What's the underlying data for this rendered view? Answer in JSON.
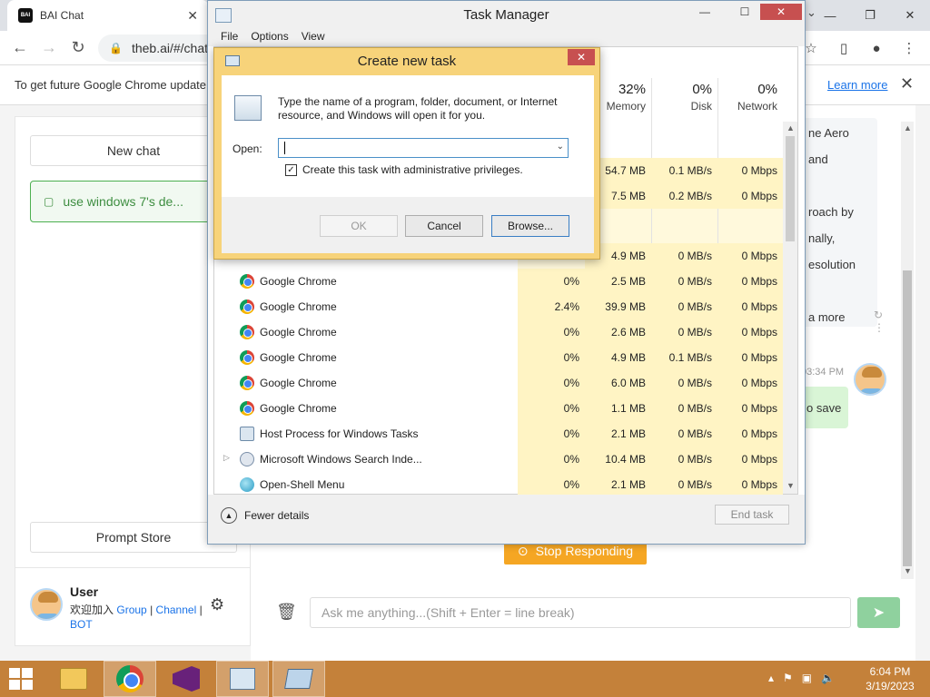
{
  "browser": {
    "tab_title": "BAI Chat",
    "favicon_text": "BAI",
    "url": "theb.ai/#/chat",
    "infobar_text": "To get future Google Chrome update",
    "infobar_link": "Learn more"
  },
  "sidebar": {
    "new_chat": "New chat",
    "chat_item": "use windows 7's de...",
    "prompt_store": "Prompt Store",
    "user_name": "User",
    "user_join": "欢迎加入",
    "link_group": "Group",
    "link_channel": "Channel",
    "link_bot": "BOT",
    "sep": "|"
  },
  "chat": {
    "bubble_lines": [
      "ne Aero",
      "and",
      "",
      "roach by",
      "nally,",
      "esolution",
      "",
      "a more"
    ],
    "timestamp": "03:34 PM",
    "green_bubble": "o save",
    "stop_button": "Stop Responding",
    "input_placeholder": "Ask me anything...(Shift + Enter = line break)"
  },
  "task_manager": {
    "title": "Task Manager",
    "menu": [
      "File",
      "Options",
      "View"
    ],
    "headers": [
      {
        "pct": "32%",
        "label": "Memory"
      },
      {
        "pct": "0%",
        "label": "Disk"
      },
      {
        "pct": "0%",
        "label": "Network"
      }
    ],
    "partial_rows": [
      {
        "mem": "54.7 MB",
        "disk": "0.1 MB/s",
        "net": "0 Mbps"
      },
      {
        "mem": "7.5 MB",
        "disk": "0.2 MB/s",
        "net": "0 Mbps"
      },
      {
        "mem": "4.9 MB",
        "disk": "0 MB/s",
        "net": "0 Mbps"
      }
    ],
    "processes": [
      {
        "name": "Google Chrome",
        "icon": "chrome-icon",
        "cpu": "0%",
        "mem": "2.5 MB",
        "disk": "0 MB/s",
        "net": "0 Mbps"
      },
      {
        "name": "Google Chrome",
        "icon": "chrome-icon",
        "cpu": "2.4%",
        "mem": "39.9 MB",
        "disk": "0 MB/s",
        "net": "0 Mbps"
      },
      {
        "name": "Google Chrome",
        "icon": "chrome-icon",
        "cpu": "0%",
        "mem": "2.6 MB",
        "disk": "0 MB/s",
        "net": "0 Mbps"
      },
      {
        "name": "Google Chrome",
        "icon": "chrome-icon",
        "cpu": "0%",
        "mem": "4.9 MB",
        "disk": "0.1 MB/s",
        "net": "0 Mbps"
      },
      {
        "name": "Google Chrome",
        "icon": "chrome-icon",
        "cpu": "0%",
        "mem": "6.0 MB",
        "disk": "0 MB/s",
        "net": "0 Mbps"
      },
      {
        "name": "Google Chrome",
        "icon": "chrome-icon",
        "cpu": "0%",
        "mem": "1.1 MB",
        "disk": "0 MB/s",
        "net": "0 Mbps"
      },
      {
        "name": "Host Process for Windows Tasks",
        "icon": "host-process-icon",
        "cpu": "0%",
        "mem": "2.1 MB",
        "disk": "0 MB/s",
        "net": "0 Mbps"
      },
      {
        "name": "Microsoft Windows Search Inde...",
        "icon": "search-indexer-icon",
        "cpu": "0%",
        "mem": "10.4 MB",
        "disk": "0 MB/s",
        "net": "0 Mbps",
        "expandable": true
      },
      {
        "name": "Open-Shell Menu",
        "icon": "open-shell-icon",
        "cpu": "0%",
        "mem": "2.1 MB",
        "disk": "0 MB/s",
        "net": "0 Mbps"
      }
    ],
    "fewer_details": "Fewer details",
    "end_task": "End task"
  },
  "dialog": {
    "title": "Create new task",
    "description": "Type the name of a program, folder, document, or Internet resource, and Windows will open it for you.",
    "open_label": "Open:",
    "open_value": "",
    "checkbox_label": "Create this task with administrative privileges.",
    "checkbox_checked": true,
    "ok": "OK",
    "cancel": "Cancel",
    "browse": "Browse..."
  },
  "taskbar": {
    "clock_time": "6:04 PM",
    "clock_date": "3/19/2023"
  },
  "colors": {
    "accent_green": "#4caf50",
    "stop_orange": "#f5a623",
    "taskbar": "#c4813a",
    "dialog_frame": "#f7d37a"
  }
}
